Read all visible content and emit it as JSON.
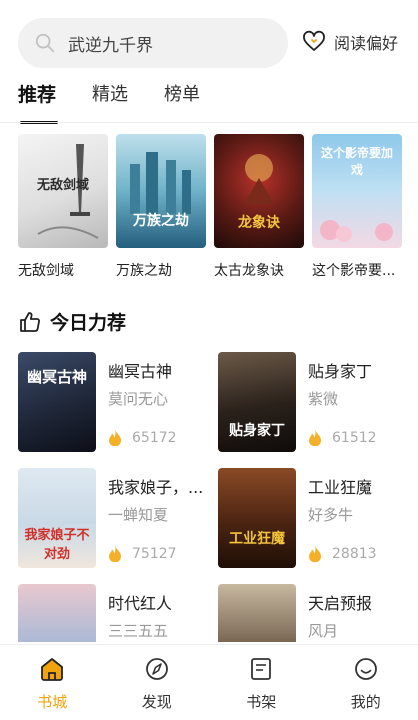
{
  "search": {
    "text": "武逆九千界"
  },
  "header": {
    "pref_label": "阅读偏好"
  },
  "tabs": [
    {
      "label": "推荐"
    },
    {
      "label": "精选"
    },
    {
      "label": "榜单"
    }
  ],
  "featured": [
    {
      "title": "无敌剑域",
      "cover_text": "无敌剑域"
    },
    {
      "title": "万族之劫",
      "cover_text": "万族之劫"
    },
    {
      "title": "太古龙象诀",
      "cover_text": "龙象诀"
    },
    {
      "title": "这个影帝要...",
      "cover_text": "这个影帝要加戏"
    }
  ],
  "section": {
    "title": "今日力荐"
  },
  "books": [
    {
      "name": "幽冥古神",
      "author": "莫问无心",
      "heat": "65172",
      "cover_text": "幽冥古神"
    },
    {
      "name": "贴身家丁",
      "author": "紫微",
      "heat": "61512",
      "cover_text": "贴身家丁"
    },
    {
      "name": "我家娘子，...",
      "author": "一蝉知夏",
      "heat": "75127",
      "cover_text": "我家娘子不对劲"
    },
    {
      "name": "工业狂魔",
      "author": "好多牛",
      "heat": "28813",
      "cover_text": "工业狂魔"
    },
    {
      "name": "时代红人",
      "author": "三三五五",
      "heat": "",
      "cover_text": ""
    },
    {
      "name": "天启预报",
      "author": "风月",
      "heat": "",
      "cover_text": ""
    }
  ],
  "nav": [
    {
      "label": "书城",
      "icon": "home-icon",
      "active": true
    },
    {
      "label": "发现",
      "icon": "discover-icon",
      "active": false
    },
    {
      "label": "书架",
      "icon": "bookshelf-icon",
      "active": false
    },
    {
      "label": "我的",
      "icon": "profile-icon",
      "active": false
    }
  ],
  "colors": {
    "accent": "#f1a30c",
    "heat": "#f5b02a"
  }
}
